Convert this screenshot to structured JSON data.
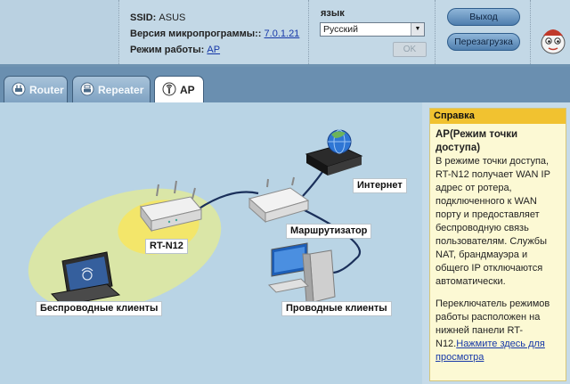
{
  "header": {
    "ssid_label": "SSID:",
    "ssid_value": "ASUS",
    "firmware_label": "Версия микропрограммы::",
    "firmware_value": "7.0.1.21",
    "mode_label": "Режим работы:",
    "mode_value": "AP",
    "language_label": "язык",
    "language_value": "Русский",
    "ok_label": "OK",
    "logout_label": "Выход",
    "reboot_label": "Перезагрузка"
  },
  "tabs": [
    {
      "label": "Router"
    },
    {
      "label": "Repeater"
    },
    {
      "label": "AP"
    }
  ],
  "diagram": {
    "internet": "Интернет",
    "router": "Маршрутизатор",
    "device": "RT-N12",
    "wireless_clients": "Беспроводные клиенты",
    "wired_clients": "Проводные клиенты"
  },
  "help": {
    "title": "Справка",
    "heading": "AP(Режим точки доступа)",
    "paragraph1": "В режиме точки доступа, RT-N12 получает WAN IP адрес от ротера, подключенного к WAN порту и предоставляет беспроводную связь пользователям. Службы NAT, брандмауэра и общего IP отключаются автоматически.",
    "paragraph2": "Переключатель режимов работы расположен на нижней панели RT-N12.",
    "link": "Нажмите здесь для просмотра"
  },
  "colors": {
    "accent_blue": "#1638a8",
    "help_header": "#f1c230",
    "tab_bar": "#6a8fb0"
  }
}
